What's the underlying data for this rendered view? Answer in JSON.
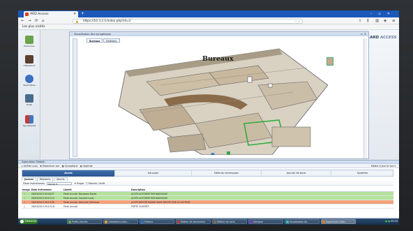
{
  "browser": {
    "tab_title": "ARD Access",
    "url": "https://10.3.2.1/index.php?id=2",
    "bookmark": "Les plus visités"
  },
  "leftbar": {
    "items": [
      {
        "label": "Personnes",
        "icon": "person-icon",
        "color": "#6aa34a"
      },
      {
        "label": "Utilisateurs",
        "icon": "user-icon",
        "color": "#5a4030"
      },
      {
        "label": "Paramètres",
        "icon": "gear-icon",
        "color": "#3b6fbf"
      },
      {
        "label": "Poste",
        "icon": "monitor-icon",
        "color": "#4b6b8a"
      },
      {
        "label": "Synoptiques",
        "icon": "grid-icon",
        "color": "#c23c3c"
      }
    ]
  },
  "logo": {
    "brand": "ARD",
    "product": "ACCESS"
  },
  "synoptique": {
    "title": "Visualisation des synoptiques",
    "tabs": [
      "Bureaux",
      "Extérieur"
    ],
    "floor_label": "Bureaux"
  },
  "supervision": {
    "title": "Supervision Globale",
    "tools": [
      "Arrêter scan",
      "Désactiver son",
      "Synoptique",
      "Légende"
    ],
    "right_tool": "Mettre à jour la vue ▾",
    "module_tabs": [
      "Accès",
      "Intrusion",
      "Défauts techniques",
      "Journal de bord",
      "Système"
    ],
    "active_module": "Accès",
    "sub_tabs": [
      "Journal",
      "Résidents",
      "Alarme"
    ],
    "filter_label": "Filtrer évènements",
    "filter_value": "Aucun",
    "filter_purge": "Purger",
    "filter_autoscroll": "Marche / Arrêt",
    "columns": [
      "Image",
      "Date évènement",
      "Libellé",
      "Description"
    ],
    "rows": [
      {
        "date": "26/03/2013 09:28:57",
        "label": "Porte Accueil, Bourgeau Dante",
        "desc": "ACCÈS AUTORISÉ PAR BADGEAGE",
        "color": "#b4e29a"
      },
      {
        "date": "26/03/2013 09:15:14",
        "label": "Porte Accueil, Gaumet Louis",
        "desc": "ACCÈS AUTORISÉ PAR BADGEAGE",
        "color": "#b4e29a"
      },
      {
        "date": "26/03/2013 09:13:36",
        "label": "Porte Accueil, Doucard Clémence",
        "desc": "ACCÈS REFUSÉ BADGE SANS DROITS SUR LE LECTEUR",
        "color": "#f3a27a"
      },
      {
        "date": "26/03/2013 09:13:18",
        "label": "Porte Accueil",
        "desc": "PORTE OUVERTE",
        "color": "#ffffff"
      }
    ]
  },
  "taskbar": {
    "start": "Démarrer",
    "items": [
      "Profils d'accès",
      "Calendriers indiv...",
      "Portiers",
      "Éditeur de documents",
      "Éditeur de carte",
      "Intrusion",
      "Visualisation de...",
      "Supervision Glob..."
    ],
    "clock": "09:29"
  }
}
